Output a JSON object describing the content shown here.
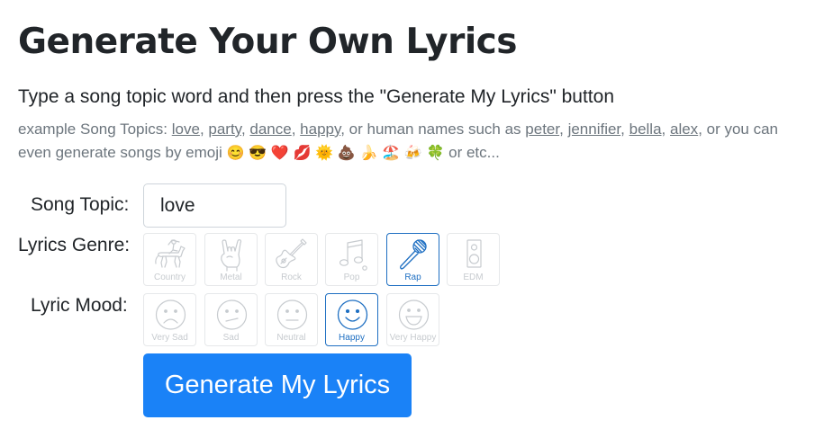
{
  "title": "Generate Your Own Lyrics",
  "instruction": "Type a song topic word and then press the \"Generate My Lyrics\" button",
  "examples": {
    "intro": "example Song Topics:",
    "topics": [
      "love",
      "party",
      "dance",
      "happy"
    ],
    "or_human": ", or human names such as",
    "names": [
      "peter",
      "jennifier",
      "bella",
      "alex"
    ],
    "emoji_intro": ", or you can even generate songs by emoji",
    "emojis": [
      "😊",
      "😎",
      "❤️",
      "💋",
      "🌞",
      "💩",
      "🍌",
      "🏖️",
      "🍻",
      "🍀"
    ],
    "etc": "or etc..."
  },
  "form": {
    "topic_label": "Song Topic:",
    "topic_value": "love",
    "genre_label": "Lyrics Genre:",
    "mood_label": "Lyric Mood:",
    "genres": [
      {
        "label": "Country",
        "selected": false,
        "icon": "horse-rider-icon"
      },
      {
        "label": "Metal",
        "selected": false,
        "icon": "rock-hand-icon"
      },
      {
        "label": "Rock",
        "selected": false,
        "icon": "electric-guitar-icon"
      },
      {
        "label": "Pop",
        "selected": false,
        "icon": "music-note-icon"
      },
      {
        "label": "Rap",
        "selected": true,
        "icon": "microphone-icon"
      },
      {
        "label": "EDM",
        "selected": false,
        "icon": "speaker-icon"
      }
    ],
    "moods": [
      {
        "label": "Very Sad",
        "selected": false,
        "icon": "very-sad-face-icon"
      },
      {
        "label": "Sad",
        "selected": false,
        "icon": "sad-face-icon"
      },
      {
        "label": "Neutral",
        "selected": false,
        "icon": "neutral-face-icon"
      },
      {
        "label": "Happy",
        "selected": true,
        "icon": "happy-face-icon"
      },
      {
        "label": "Very Happy",
        "selected": false,
        "icon": "very-happy-face-icon"
      }
    ],
    "submit_label": "Generate My Lyrics"
  },
  "colors": {
    "accent": "#1a82f7",
    "selected_border": "#1e6fc2",
    "muted_text": "#6c757d",
    "inactive_icon": "#c7cbcf"
  }
}
